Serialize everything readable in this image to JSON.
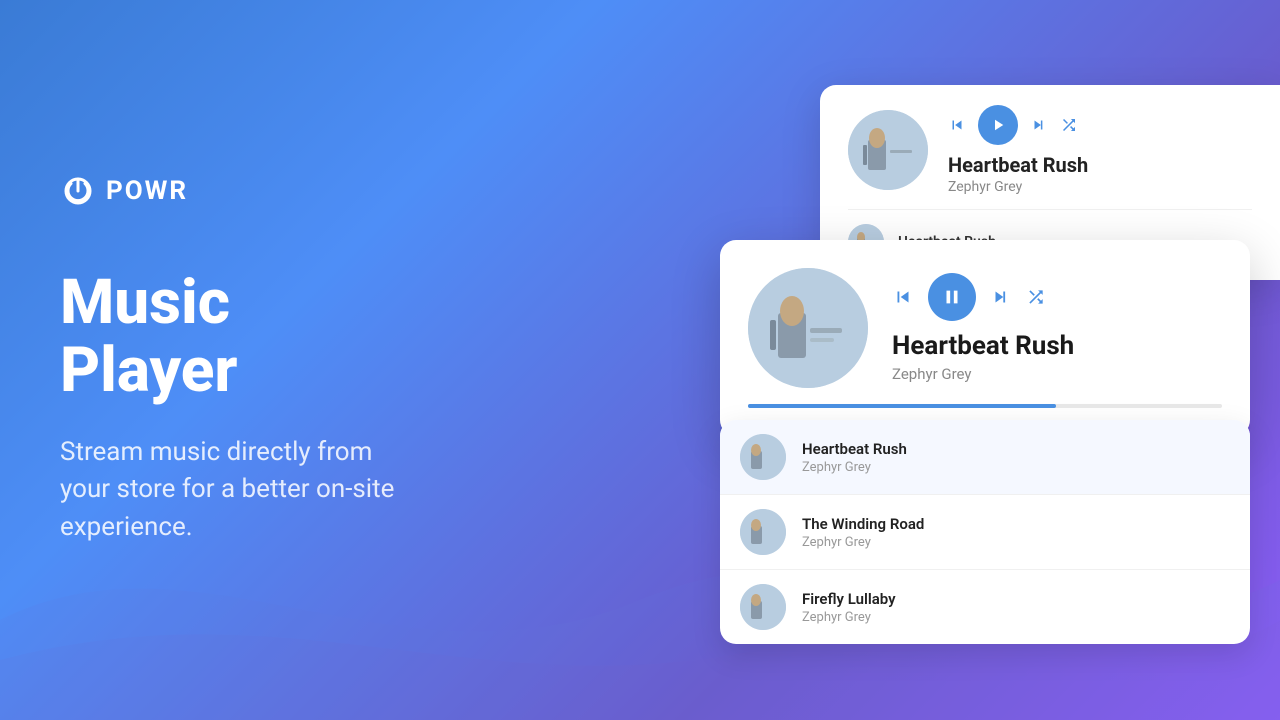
{
  "brand": {
    "logo_text": "POWR",
    "logo_icon": "power-icon"
  },
  "hero": {
    "title": "Music Player",
    "description": "Stream music directly from your store for a better on-site experience."
  },
  "player1": {
    "track_title": "Heartbeat Rush",
    "track_artist": "Zephyr Grey",
    "list_track": "Heartbeat Rush"
  },
  "player2": {
    "track_title": "Heartbeat Rush",
    "track_artist": "Zephyr Grey",
    "progress_percent": 65
  },
  "playlist": {
    "items": [
      {
        "title": "Heartbeat Rush",
        "artist": "Zephyr Grey",
        "active": true
      },
      {
        "title": "The Winding Road",
        "artist": "Zephyr Grey",
        "active": false
      },
      {
        "title": "Firefly Lullaby",
        "artist": "Zephyr Grey",
        "active": false
      }
    ]
  }
}
